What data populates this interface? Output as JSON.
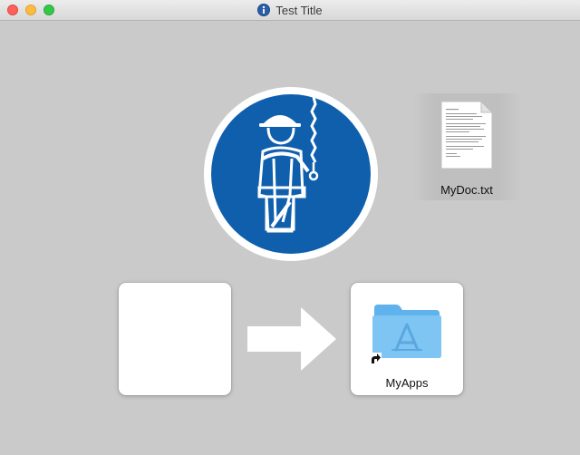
{
  "window": {
    "title": "Test Title",
    "title_icon": "installer-disk-icon",
    "traffic_lights": [
      "close",
      "minimize",
      "zoom"
    ]
  },
  "content": {
    "background_icon": "safety-harness-sign-icon",
    "document": {
      "label": "MyDoc.txt",
      "icon": "text-document-icon"
    },
    "source_tile": {
      "icon": "blank-app-tile"
    },
    "arrow": {
      "icon": "right-arrow-icon"
    },
    "target": {
      "label": "MyApps",
      "icon": "applications-folder-alias-icon"
    }
  },
  "colors": {
    "sign_blue": "#0f5fad",
    "folder_blue": "#64b6f0",
    "window_bg": "#cacaca"
  }
}
